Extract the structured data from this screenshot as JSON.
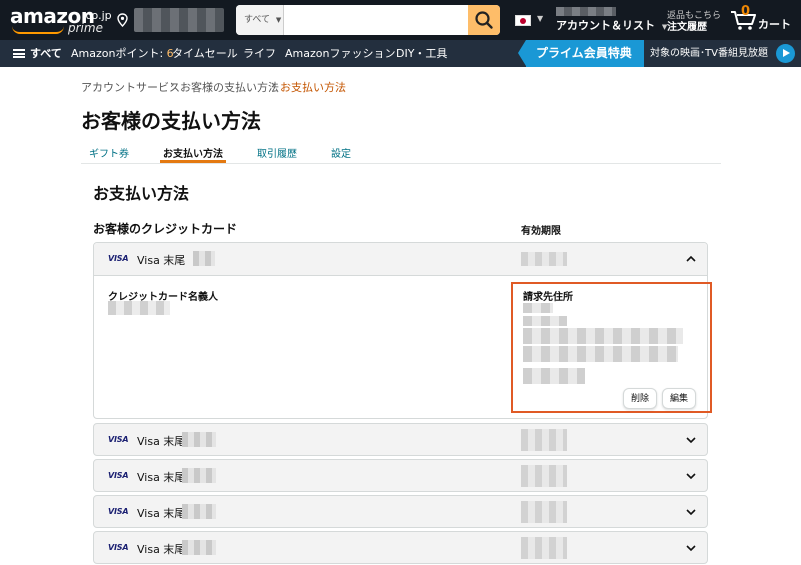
{
  "header": {
    "logo_text": "amazon",
    "logo_tld": ".co.jp",
    "logo_prime": "prime",
    "search": {
      "category": "すべて",
      "value": "",
      "placeholder": ""
    },
    "account_label": "アカウント＆リスト",
    "returns_line1": "返品もこちら",
    "returns_line2": "注文履歴",
    "cart_count": "0",
    "cart_label": "カート"
  },
  "nav": {
    "all_label": "すべて",
    "points_label": "Amazonポイント: ",
    "points_value": "6",
    "items": [
      "タイムセール",
      "ライフ",
      "Amazonファッション",
      "DIY・工具"
    ],
    "prime_banner": "プライム会員特典",
    "prime_video": "対象の映画･TV番組見放題"
  },
  "breadcrumb": {
    "items": [
      "アカウントサービス",
      "お客様の支払い方法",
      "お支払い方法"
    ],
    "separator": "›"
  },
  "page_title": "お客様の支払い方法",
  "tabs": [
    {
      "label": "ギフト券",
      "active": false
    },
    {
      "label": "お支払い方法",
      "active": true
    },
    {
      "label": "取引履歴",
      "active": false
    },
    {
      "label": "設定",
      "active": false
    }
  ],
  "section_title": "お支払い方法",
  "columns": {
    "cards": "お客様のクレジットカード",
    "expiry": "有効期限"
  },
  "cards": [
    {
      "brand": "VISA",
      "label": "Visa 末尾",
      "expanded": true
    },
    {
      "brand": "VISA",
      "label": "Visa 末尾",
      "expanded": false
    },
    {
      "brand": "VISA",
      "label": "Visa 末尾",
      "expanded": false
    },
    {
      "brand": "VISA",
      "label": "Visa 末尾",
      "expanded": false
    },
    {
      "brand": "VISA",
      "label": "Visa 末尾",
      "expanded": false
    }
  ],
  "details": {
    "holder_label": "クレジットカード名義人",
    "billing_label": "請求先住所",
    "delete_button": "削除",
    "edit_button": "編集"
  },
  "colors": {
    "nav_dark": "#131921",
    "nav_secondary": "#232f3e",
    "search_button": "#febd69",
    "prime_blue": "#1a98d5",
    "link": "#007185",
    "active_tab": "#e47911",
    "highlight_box": "#e05a25"
  }
}
